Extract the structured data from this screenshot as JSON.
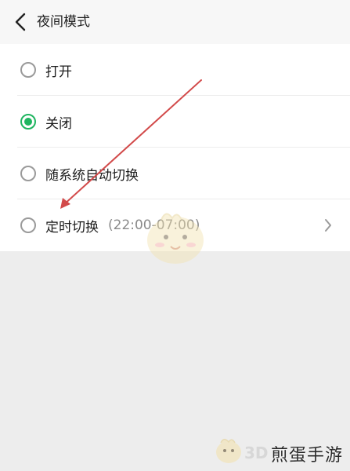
{
  "header": {
    "title": "夜间模式",
    "back_icon": "chevron-left-icon"
  },
  "options": [
    {
      "label": "打开",
      "selected": false
    },
    {
      "label": "关闭",
      "selected": true
    },
    {
      "label": "随系统自动切换",
      "selected": false
    },
    {
      "label": "定时切换",
      "sub": "(22:00-07:00)",
      "selected": false,
      "chevron_icon": "chevron-right-icon"
    }
  ],
  "colors": {
    "accent": "#1fb560",
    "annotation_arrow": "#d24a4a"
  },
  "watermark": {
    "text": "煎蛋手游",
    "logo_text": "3D"
  }
}
